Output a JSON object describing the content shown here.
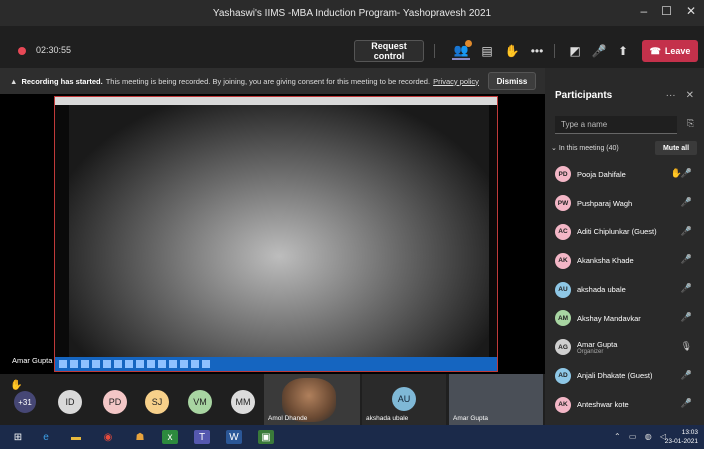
{
  "window": {
    "title": "Yashaswi's IIMS -MBA Induction Program- Yashopravesh 2021"
  },
  "toolbar": {
    "timer": "02:30:55",
    "request_control": "Request control",
    "leave": "Leave"
  },
  "banner": {
    "bold": "Recording has started.",
    "text": "This meeting is being recorded. By joining, you are giving consent for this meeting to be recorded.",
    "link": "Privacy policy",
    "dismiss": "Dismiss"
  },
  "stage": {
    "presenter": "Amar Gupta"
  },
  "attendees": {
    "more": "+31",
    "avatars": [
      {
        "initials": "ID",
        "color": "#d9d9d9"
      },
      {
        "initials": "PD",
        "color": "#f3c6c6"
      },
      {
        "initials": "SJ",
        "color": "#f7d08a"
      },
      {
        "initials": "VM",
        "color": "#a8d5a2"
      },
      {
        "initials": "MM",
        "color": "#dcdcdc"
      }
    ],
    "video_name": "Amol Dhande",
    "au_initials": "AU",
    "au_name": "akshada ubale",
    "video2_name": "Amar Gupta"
  },
  "panel": {
    "title": "Participants",
    "search_placeholder": "Type a name",
    "section": "In this meeting (40)",
    "mute_all": "Mute all",
    "participants": [
      {
        "initials": "PD",
        "name": "Pooja Dahifale",
        "color": "#f3b6c6",
        "hand": true
      },
      {
        "initials": "PW",
        "name": "Pushparaj Wagh",
        "color": "#f3b6c6"
      },
      {
        "initials": "AC",
        "name": "Aditi Chiplunkar (Guest)",
        "color": "#f3b6c6"
      },
      {
        "initials": "AK",
        "name": "Akanksha Khade",
        "color": "#f3b6c6"
      },
      {
        "initials": "AU",
        "name": "akshada ubale",
        "color": "#8ec7e6"
      },
      {
        "initials": "AM",
        "name": "Akshay Mandavkar",
        "color": "#a8d5a2"
      },
      {
        "initials": "AG",
        "name": "Amar Gupta",
        "role": "Organizer",
        "color": "#cfcfcf"
      },
      {
        "initials": "AD",
        "name": "Anjali Dhakate (Guest)",
        "color": "#8ec7e6"
      },
      {
        "initials": "AK",
        "name": "Anteshwar kote",
        "color": "#f3b6c6"
      }
    ]
  },
  "taskbar": {
    "time": "13:03",
    "date": "23-01-2021"
  }
}
